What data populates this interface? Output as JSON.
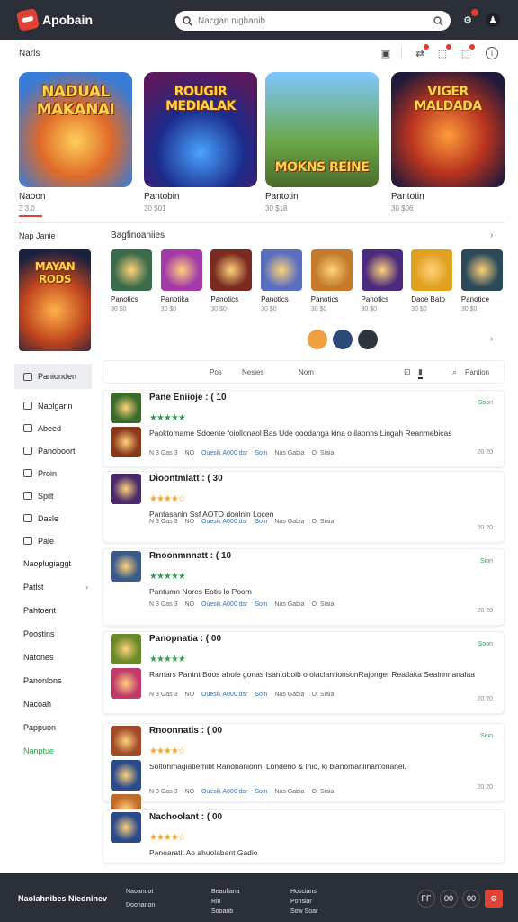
{
  "app": {
    "title": "Apobain"
  },
  "search": {
    "placeholder": "Nacgan nighanib"
  },
  "section1": {
    "title": "Narls"
  },
  "featured": [
    {
      "title": "Naoon",
      "meta": "3 3.0",
      "art": "NADUAL MAKANAI"
    },
    {
      "title": "Pantobin",
      "meta": "30 $01",
      "art": "ROUGIR MEDIALAK"
    },
    {
      "title": "Pantotin",
      "meta": "30 $18",
      "art": "MOKNS REINE"
    },
    {
      "title": "Pantotin",
      "meta": "30 $06",
      "art": "VIGER MALDADA"
    }
  ],
  "section2": {
    "left_title": "Nap Janie",
    "right_title": "Bagfinoaniies"
  },
  "promo": {
    "art": "MAYAN RODS"
  },
  "mini": [
    {
      "title": "Panotics",
      "meta": "30 $0"
    },
    {
      "title": "Panotika",
      "meta": "30 $0"
    },
    {
      "title": "Panotics",
      "meta": "30 $0"
    },
    {
      "title": "Panotics",
      "meta": "30 $0"
    },
    {
      "title": "Panotics",
      "meta": "30 $0"
    },
    {
      "title": "Panotics",
      "meta": "30 $0"
    },
    {
      "title": "Daoe Bato",
      "meta": "30 $0"
    },
    {
      "title": "Panotice",
      "meta": "30 $0"
    }
  ],
  "sidebar": {
    "items": [
      {
        "label": "Panionden"
      },
      {
        "label": "Naolgann"
      },
      {
        "label": "Abeed"
      },
      {
        "label": "Panoboort"
      },
      {
        "label": "Proin"
      },
      {
        "label": "Spilt"
      },
      {
        "label": "Dasle"
      },
      {
        "label": "Pale"
      },
      {
        "label": "Naoplugiaggt"
      },
      {
        "label": "Patlst"
      },
      {
        "label": "Pahtoent"
      },
      {
        "label": "Poostins"
      },
      {
        "label": "Natones"
      },
      {
        "label": "Panonlons"
      },
      {
        "label": "Nacoah"
      },
      {
        "label": "Pappuon"
      },
      {
        "label": "Nanptue"
      }
    ]
  },
  "tabs": {
    "labels": [
      "Pos",
      "Nesies",
      "Nom"
    ],
    "sort": "Pantion"
  },
  "cards": [
    {
      "title": "Pane Eniioje : ( 10",
      "desc": "Paoktomame Sdoente foiollonaol Bas Ude ooodanga kina o ilapnns Lingah Reanmebicas",
      "status": "Soon",
      "ago": "20 20",
      "stars": "★★★★★"
    },
    {
      "title": "Dioontmlatt : ( 30",
      "desc": "Pantasanin Ssf AOTO donlnin Locen",
      "status": "",
      "ago": "20 20",
      "stars": "★★★★☆"
    },
    {
      "title": "Rnoonmnnatt : ( 10",
      "desc": "Pantumn Nores Eotis lo Poom",
      "status": "Sion",
      "ago": "20 20",
      "stars": "★★★★★"
    },
    {
      "title": "Panopnatia : ( 00",
      "desc": "Ramars Pantnt Boos ahole gonas Isantoboib o olaclantionsonRajonger Reatlaka Sealnnnanalaa",
      "status": "Soon",
      "ago": "20 20",
      "stars": "★★★★★"
    },
    {
      "title": "Rnoonnatis : ( 00",
      "desc": "Soltohmagiatiemibt Ranobanionn, Londerio & Inio, ki bianomanlinantorianel.",
      "status": "Sion",
      "ago": "20 20",
      "stars": "★★★★☆"
    },
    {
      "title": "Naohoolant : ( 00",
      "desc": "Panoaratit Ao ahuolabant Gadio",
      "status": "",
      "ago": "",
      "stars": "★★★★☆"
    }
  ],
  "card_row": {
    "a": "N 3 Gas 3",
    "b": "NO",
    "link1": "Ouesik A000 dsr",
    "link2": "Soin",
    "c": "Nas Gabia",
    "d": "O: Siaia"
  },
  "footer": {
    "brand": "Naolahnibes Niedninev",
    "col1": [
      "Naoanuot",
      "Doonanon"
    ],
    "col2": [
      "Beaufiana",
      "Rin",
      "Sooanb"
    ],
    "col3": [
      "Hoscians",
      "Ponsiar",
      "Sow Soar"
    ],
    "buttons": [
      "FF",
      "00",
      "00"
    ]
  },
  "colors": {
    "accent": "#e04336",
    "topbar": "#2b2f38",
    "link": "#3a6ea5",
    "green": "#2aa54a",
    "star": "#f5a623"
  }
}
